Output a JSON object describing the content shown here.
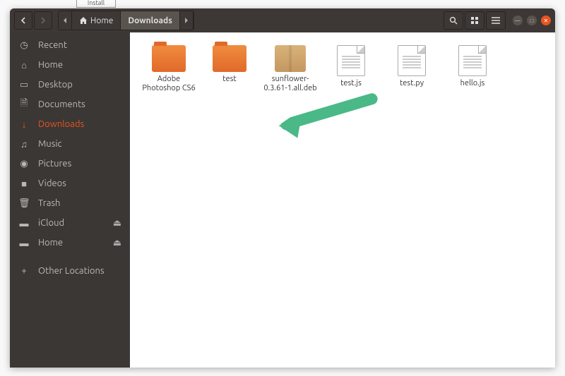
{
  "breadcrumb": {
    "home_label": "Home",
    "current_label": "Downloads"
  },
  "sidebar": {
    "items": [
      {
        "label": "Recent",
        "icon": "clock-icon",
        "active": false,
        "eject": false
      },
      {
        "label": "Home",
        "icon": "home-icon",
        "active": false,
        "eject": false
      },
      {
        "label": "Desktop",
        "icon": "desktop-icon",
        "active": false,
        "eject": false
      },
      {
        "label": "Documents",
        "icon": "document-icon",
        "active": false,
        "eject": false
      },
      {
        "label": "Downloads",
        "icon": "download-icon",
        "active": true,
        "eject": false
      },
      {
        "label": "Music",
        "icon": "music-icon",
        "active": false,
        "eject": false
      },
      {
        "label": "Pictures",
        "icon": "camera-icon",
        "active": false,
        "eject": false
      },
      {
        "label": "Videos",
        "icon": "video-icon",
        "active": false,
        "eject": false
      },
      {
        "label": "Trash",
        "icon": "trash-icon",
        "active": false,
        "eject": false
      },
      {
        "label": "iCloud",
        "icon": "drive-icon",
        "active": false,
        "eject": true
      },
      {
        "label": "Home",
        "icon": "drive-icon",
        "active": false,
        "eject": true
      }
    ],
    "other_locations_label": "Other Locations"
  },
  "files": [
    {
      "name": "Adobe Photoshop CS6",
      "type": "folder"
    },
    {
      "name": "test",
      "type": "folder"
    },
    {
      "name": "sunflower-0.3.61-1.all.deb",
      "type": "package"
    },
    {
      "name": "test.js",
      "type": "file"
    },
    {
      "name": "test.py",
      "type": "file"
    },
    {
      "name": "hello.js",
      "type": "file"
    }
  ]
}
